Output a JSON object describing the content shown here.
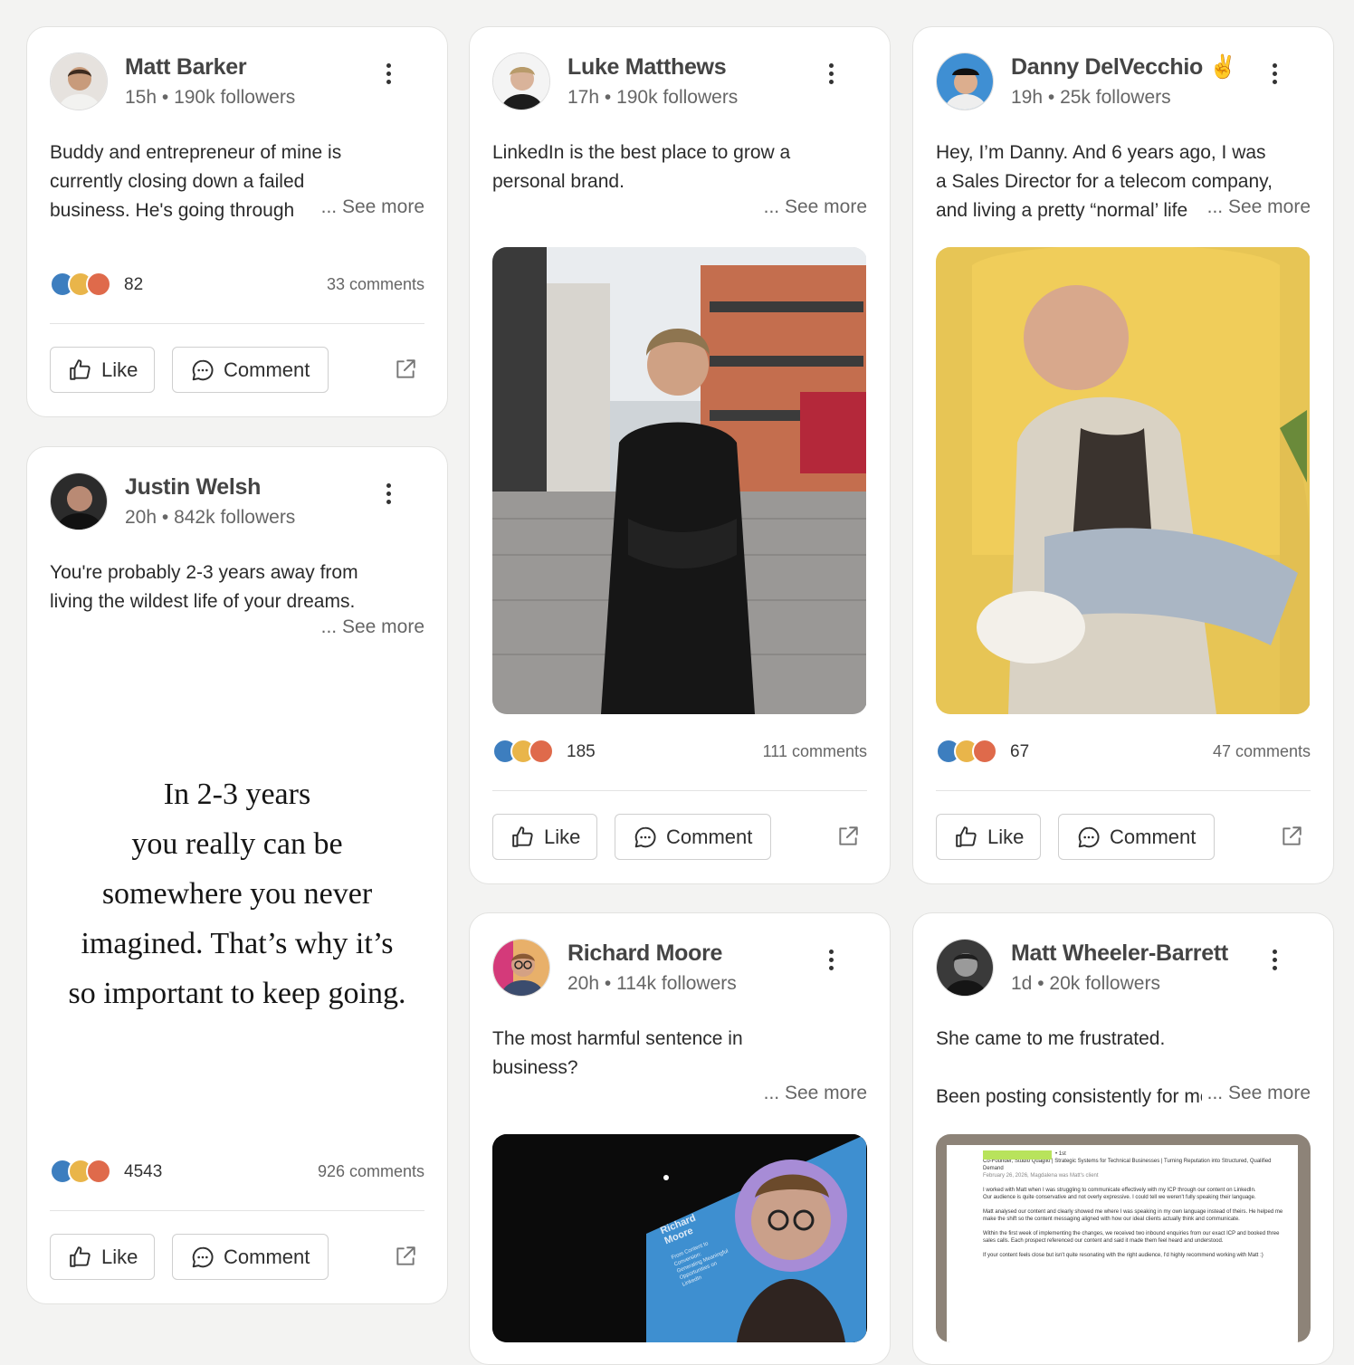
{
  "labels": {
    "like": "Like",
    "comment": "Comment",
    "see_more": "... See more"
  },
  "icons": {
    "more": "more-vertical-icon",
    "like": "thumbs-up-icon",
    "comment": "chat-bubble-icon",
    "share": "external-link-icon",
    "reactions": [
      "like-reaction-icon",
      "insightful-reaction-icon",
      "love-reaction-icon"
    ]
  },
  "colors": {
    "like_reaction": "#3d7ebf",
    "insightful_reaction": "#e9b54a",
    "love_reaction": "#df6a4b",
    "background": "#f3f3f2"
  },
  "posts": [
    {
      "name": "Matt Barker",
      "time": "15h",
      "followers": "190k followers",
      "text": [
        "Buddy and entrepreneur of mine is",
        "currently closing down a failed",
        "business. He's going through"
      ],
      "reactions": "82",
      "comments": "33 comments"
    },
    {
      "name": "Justin Welsh",
      "time": "20h",
      "followers": "842k followers",
      "text": [
        "You're probably 2-3 years away from",
        "living the wildest life of your dreams."
      ],
      "quote": [
        "In 2-3 years",
        "you really can be",
        "somewhere you never",
        "imagined. That’s why it’s",
        "so important to keep going."
      ],
      "reactions": "4543",
      "comments": "926 comments"
    },
    {
      "name": "Luke Matthews",
      "time": "17h",
      "followers": "190k followers",
      "text": [
        "LinkedIn is the best place to grow a",
        "personal brand."
      ],
      "reactions": "185",
      "comments": "111 comments"
    },
    {
      "name": "Richard Moore",
      "time": "20h",
      "followers": "114k followers",
      "text": [
        "The most harmful sentence in",
        "business?"
      ],
      "slide_text": [
        "Richard",
        "Moore",
        "From Content to",
        "Conversion:",
        "Generating Meaningful",
        "Opportunities on",
        "LinkedIn"
      ]
    },
    {
      "name": "Danny DelVecchio",
      "name_emoji": "✌️",
      "time": "19h",
      "followers": "25k followers",
      "text": [
        "Hey, I’m Danny. And 6 years ago, I was",
        "a Sales Director for a telecom company,",
        "and living a pretty “normal’ life"
      ],
      "reactions": "67",
      "comments": "47 comments"
    },
    {
      "name": "Matt Wheeler-Barrett",
      "time": "1d",
      "followers": "20k followers",
      "text": [
        "She came to me frustrated.",
        "",
        "Been posting consistently for months"
      ],
      "screenshot": {
        "degree": "• 1st",
        "headline": "Co-Founder, Studio Quaglio | Strategic Systems for Technical Businesses | Turning Reputation into Structured, Qualified Demand",
        "date": "February 26, 2026, Magdalena was Matt's client",
        "paragraphs": [
          "I worked with Matt when I was struggling to communicate effectively with my ICP through our content on LinkedIn.",
          "Our audience is quite conservative and not overly expressive. I could tell we weren't fully speaking their language.",
          "Matt analysed our content and clearly showed me where I was speaking in my own language instead of theirs. He helped me make the shift so the content messaging aligned with how our ideal clients actually think and communicate.",
          "Within the first week of implementing the changes, we received two inbound enquiries from our exact ICP and booked three sales calls. Each prospect referenced our content and said it made them feel heard and understood.",
          "If your content feels close but isn't quite resonating with the right audience, I'd highly recommend working with Matt :)"
        ]
      }
    }
  ]
}
